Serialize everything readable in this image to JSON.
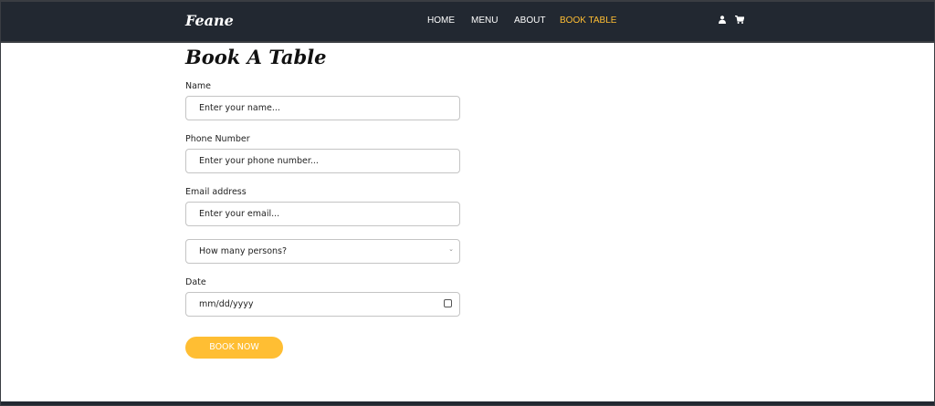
{
  "header": {
    "logo": "Feane",
    "nav": [
      {
        "label": "HOME"
      },
      {
        "label": "MENU"
      },
      {
        "label": "ABOUT"
      },
      {
        "label": "BOOK TABLE",
        "active": true
      }
    ],
    "icons": [
      "user-icon",
      "cart-icon"
    ]
  },
  "form": {
    "title": "Book A Table",
    "name": {
      "label": "Name",
      "placeholder": "Enter your name..."
    },
    "phone": {
      "label": "Phone Number",
      "placeholder": "Enter your phone number..."
    },
    "email": {
      "label": "Email address",
      "placeholder": "Enter your email..."
    },
    "persons": {
      "selected": "How many persons?"
    },
    "date": {
      "label": "Date",
      "placeholder": "mm/dd/yyyy"
    },
    "submit": "BOOK NOW"
  },
  "colors": {
    "header_bg": "#222831",
    "accent": "#ffbe33"
  }
}
